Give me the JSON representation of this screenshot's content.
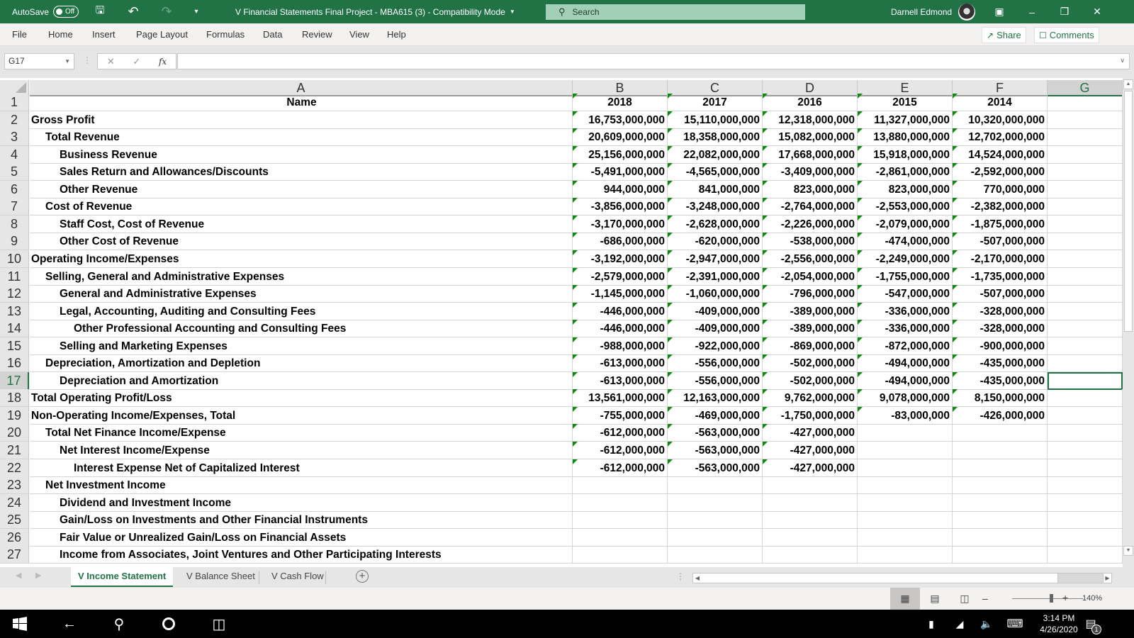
{
  "titlebar": {
    "autosave_label": "AutoSave",
    "autosave_state": "Off",
    "title": "V Financial Statements Final Project - MBA615 (3)  -  Compatibility Mode",
    "search_placeholder": "Search",
    "user_name": "Darnell Edmond"
  },
  "ribbon": {
    "tabs": [
      "File",
      "Home",
      "Insert",
      "Page Layout",
      "Formulas",
      "Data",
      "Review",
      "View",
      "Help"
    ],
    "share_label": "Share",
    "comments_label": "Comments"
  },
  "formula_bar": {
    "name_box": "G17",
    "formula": ""
  },
  "columns": [
    "A",
    "B",
    "C",
    "D",
    "E",
    "F",
    "G"
  ],
  "selected_cell": "G17",
  "rows": [
    {
      "num": "1",
      "name": "Name",
      "indent": 0,
      "values": [
        "2018",
        "2017",
        "2016",
        "2015",
        "2014"
      ]
    },
    {
      "num": "2",
      "name": "Gross Profit",
      "indent": 0,
      "values": [
        "16,753,000,000",
        "15,110,000,000",
        "12,318,000,000",
        "11,327,000,000",
        "10,320,000,000"
      ]
    },
    {
      "num": "3",
      "name": "Total Revenue",
      "indent": 1,
      "values": [
        "20,609,000,000",
        "18,358,000,000",
        "15,082,000,000",
        "13,880,000,000",
        "12,702,000,000"
      ]
    },
    {
      "num": "4",
      "name": "Business Revenue",
      "indent": 2,
      "values": [
        "25,156,000,000",
        "22,082,000,000",
        "17,668,000,000",
        "15,918,000,000",
        "14,524,000,000"
      ]
    },
    {
      "num": "5",
      "name": "Sales Return and Allowances/Discounts",
      "indent": 2,
      "values": [
        "-5,491,000,000",
        "-4,565,000,000",
        "-3,409,000,000",
        "-2,861,000,000",
        "-2,592,000,000"
      ]
    },
    {
      "num": "6",
      "name": "Other Revenue",
      "indent": 2,
      "values": [
        "944,000,000",
        "841,000,000",
        "823,000,000",
        "823,000,000",
        "770,000,000"
      ]
    },
    {
      "num": "7",
      "name": "Cost of Revenue",
      "indent": 1,
      "values": [
        "-3,856,000,000",
        "-3,248,000,000",
        "-2,764,000,000",
        "-2,553,000,000",
        "-2,382,000,000"
      ]
    },
    {
      "num": "8",
      "name": "Staff Cost, Cost of Revenue",
      "indent": 2,
      "values": [
        "-3,170,000,000",
        "-2,628,000,000",
        "-2,226,000,000",
        "-2,079,000,000",
        "-1,875,000,000"
      ]
    },
    {
      "num": "9",
      "name": "Other Cost of Revenue",
      "indent": 2,
      "values": [
        "-686,000,000",
        "-620,000,000",
        "-538,000,000",
        "-474,000,000",
        "-507,000,000"
      ]
    },
    {
      "num": "10",
      "name": "Operating Income/Expenses",
      "indent": 0,
      "values": [
        "-3,192,000,000",
        "-2,947,000,000",
        "-2,556,000,000",
        "-2,249,000,000",
        "-2,170,000,000"
      ]
    },
    {
      "num": "11",
      "name": "Selling, General and Administrative Expenses",
      "indent": 1,
      "values": [
        "-2,579,000,000",
        "-2,391,000,000",
        "-2,054,000,000",
        "-1,755,000,000",
        "-1,735,000,000"
      ]
    },
    {
      "num": "12",
      "name": "General and Administrative Expenses",
      "indent": 2,
      "values": [
        "-1,145,000,000",
        "-1,060,000,000",
        "-796,000,000",
        "-547,000,000",
        "-507,000,000"
      ]
    },
    {
      "num": "13",
      "name": "Legal, Accounting, Auditing and Consulting Fees",
      "indent": 2,
      "values": [
        "-446,000,000",
        "-409,000,000",
        "-389,000,000",
        "-336,000,000",
        "-328,000,000"
      ]
    },
    {
      "num": "14",
      "name": "Other Professional Accounting and Consulting Fees",
      "indent": 3,
      "values": [
        "-446,000,000",
        "-409,000,000",
        "-389,000,000",
        "-336,000,000",
        "-328,000,000"
      ]
    },
    {
      "num": "15",
      "name": "Selling and Marketing Expenses",
      "indent": 2,
      "values": [
        "-988,000,000",
        "-922,000,000",
        "-869,000,000",
        "-872,000,000",
        "-900,000,000"
      ]
    },
    {
      "num": "16",
      "name": "Depreciation, Amortization and Depletion",
      "indent": 1,
      "values": [
        "-613,000,000",
        "-556,000,000",
        "-502,000,000",
        "-494,000,000",
        "-435,000,000"
      ]
    },
    {
      "num": "17",
      "name": "Depreciation and Amortization",
      "indent": 2,
      "values": [
        "-613,000,000",
        "-556,000,000",
        "-502,000,000",
        "-494,000,000",
        "-435,000,000"
      ]
    },
    {
      "num": "18",
      "name": "Total Operating Profit/Loss",
      "indent": 0,
      "values": [
        "13,561,000,000",
        "12,163,000,000",
        "9,762,000,000",
        "9,078,000,000",
        "8,150,000,000"
      ]
    },
    {
      "num": "19",
      "name": "Non-Operating Income/Expenses, Total",
      "indent": 0,
      "values": [
        "-755,000,000",
        "-469,000,000",
        "-1,750,000,000",
        "-83,000,000",
        "-426,000,000"
      ]
    },
    {
      "num": "20",
      "name": "Total Net Finance Income/Expense",
      "indent": 1,
      "values": [
        "-612,000,000",
        "-563,000,000",
        "-427,000,000",
        "",
        ""
      ]
    },
    {
      "num": "21",
      "name": "Net Interest Income/Expense",
      "indent": 2,
      "values": [
        "-612,000,000",
        "-563,000,000",
        "-427,000,000",
        "",
        ""
      ]
    },
    {
      "num": "22",
      "name": "Interest Expense Net of Capitalized Interest",
      "indent": 3,
      "values": [
        "-612,000,000",
        "-563,000,000",
        "-427,000,000",
        "",
        ""
      ]
    },
    {
      "num": "23",
      "name": "Net Investment Income",
      "indent": 1,
      "values": [
        "",
        "",
        "",
        "",
        ""
      ]
    },
    {
      "num": "24",
      "name": "Dividend and Investment Income",
      "indent": 2,
      "values": [
        "",
        "",
        "",
        "",
        ""
      ]
    },
    {
      "num": "25",
      "name": "Gain/Loss on Investments and Other Financial Instruments",
      "indent": 2,
      "values": [
        "",
        "",
        "",
        "",
        ""
      ]
    },
    {
      "num": "26",
      "name": "Fair Value or Unrealized Gain/Loss on Financial Assets",
      "indent": 2,
      "values": [
        "",
        "",
        "",
        "",
        ""
      ]
    },
    {
      "num": "27",
      "name": "Income from Associates, Joint Ventures and Other Participating Interests",
      "indent": 2,
      "values": [
        "",
        "",
        "",
        "",
        ""
      ]
    }
  ],
  "sheets": [
    {
      "label": "V Income Statement",
      "active": true
    },
    {
      "label": "V Balance Sheet",
      "active": false
    },
    {
      "label": "V Cash Flow",
      "active": false
    }
  ],
  "statusbar": {
    "zoom": "140%"
  },
  "taskbar": {
    "time": "3:14 PM",
    "date": "4/26/2020",
    "notification_count": "1"
  },
  "colors": {
    "accent": "#217346",
    "error_indicator": "#118811"
  }
}
